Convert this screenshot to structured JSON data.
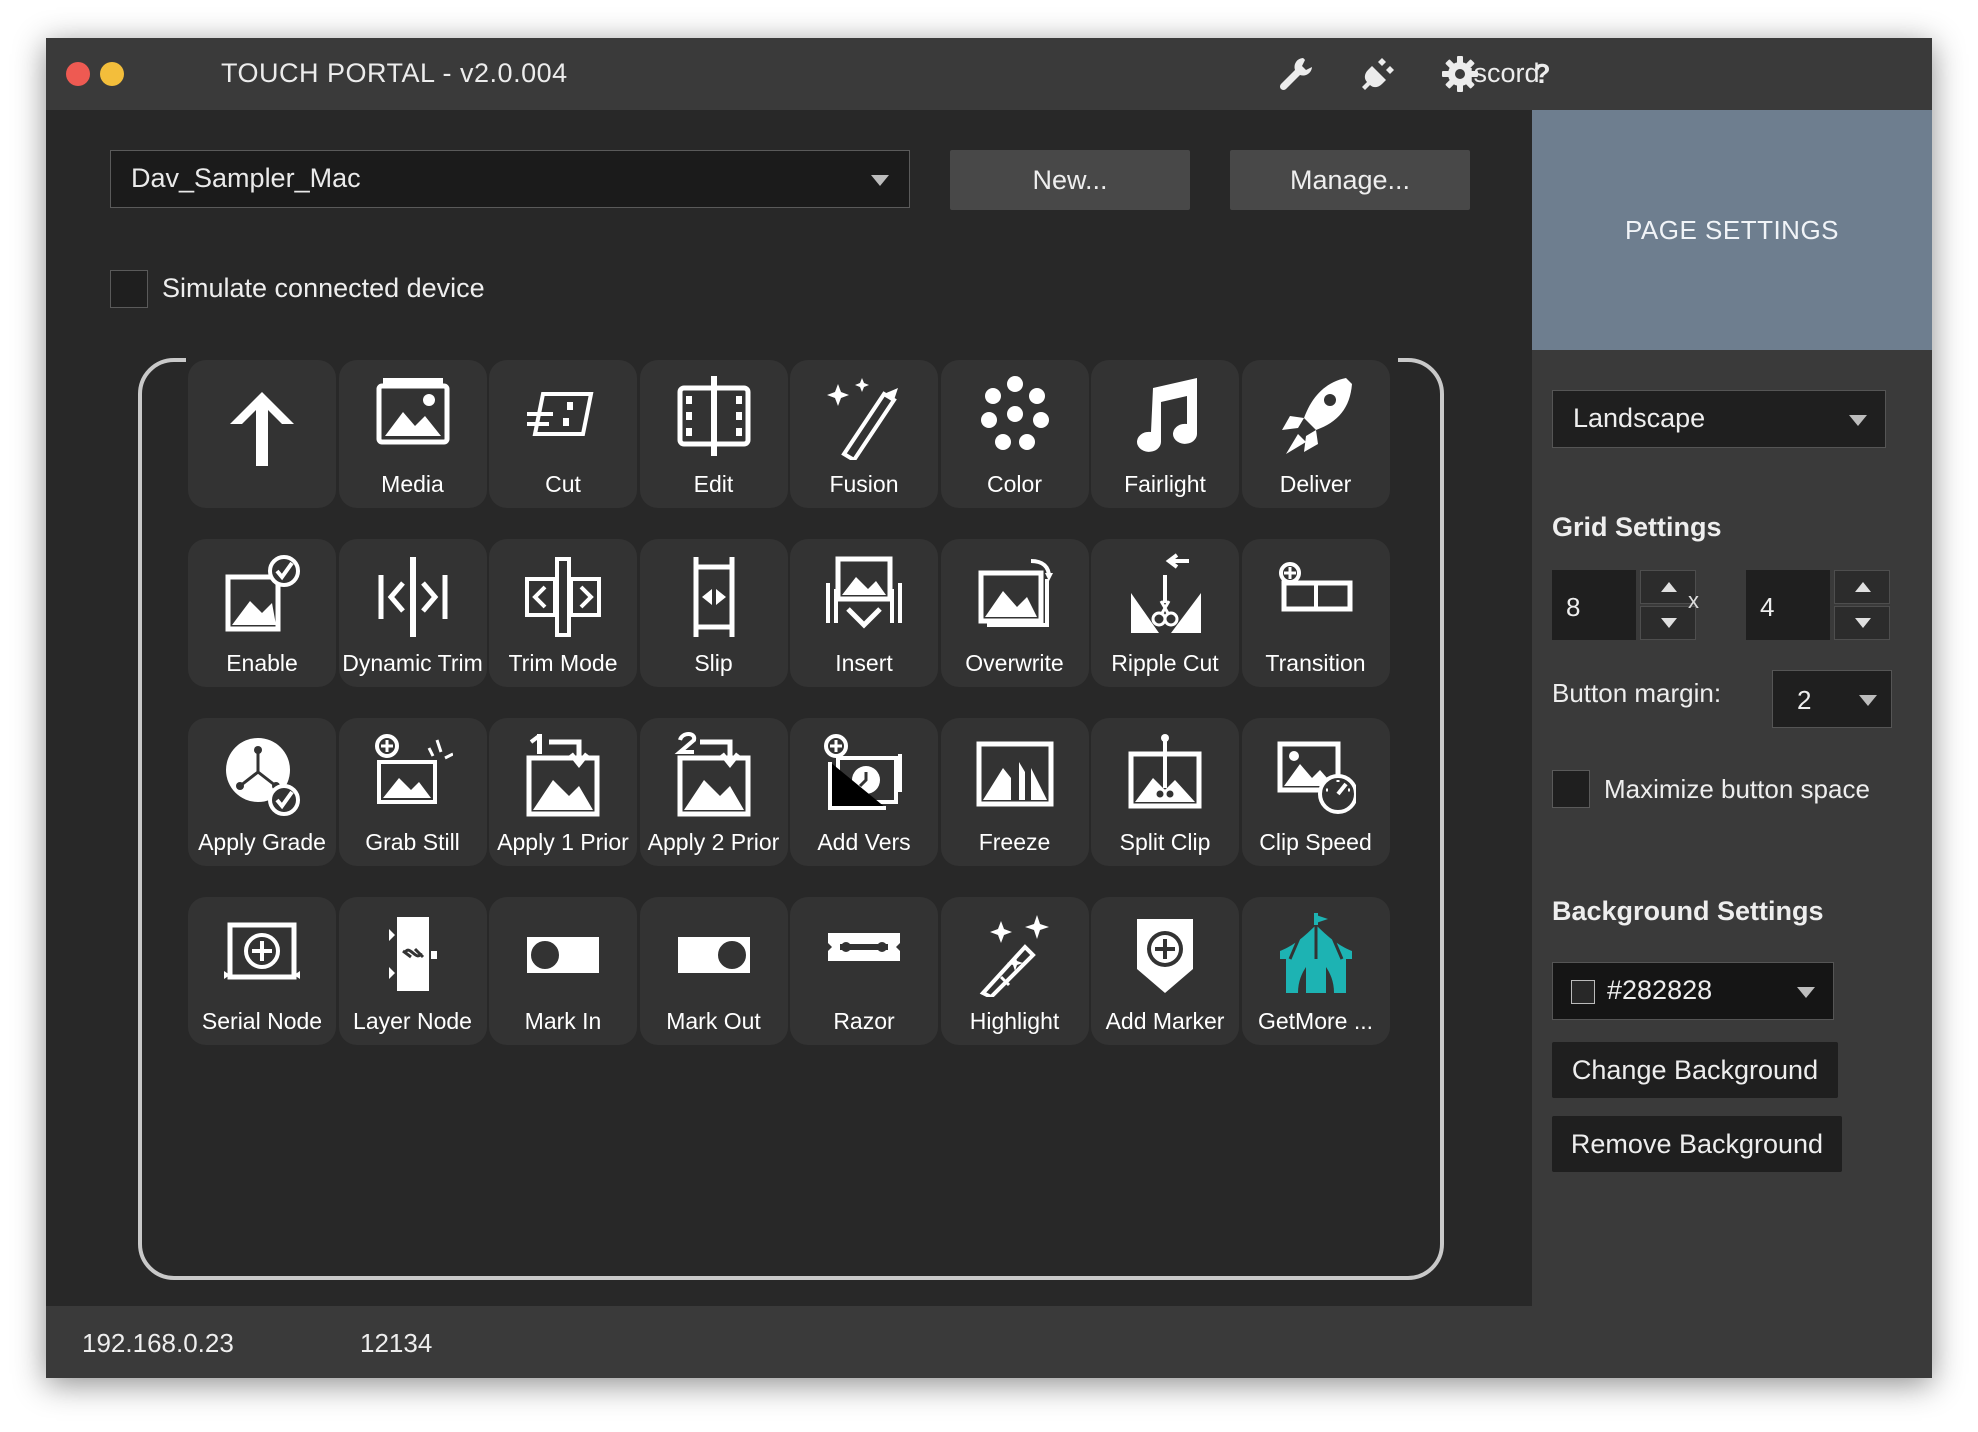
{
  "window": {
    "title": "TOUCH PORTAL - v2.0.004",
    "discord_label": "Discord",
    "help_label": "?",
    "icons": [
      "wrench-icon",
      "plug-icon",
      "gear-icon",
      "help-icon"
    ]
  },
  "toolbar": {
    "page_name": "Dav_Sampler_Mac",
    "new_label": "New...",
    "manage_label": "Manage..."
  },
  "simulate": {
    "label": "Simulate connected device",
    "checked": false
  },
  "grid": {
    "tiles": [
      {
        "label": "",
        "icon": "arrow-up-icon"
      },
      {
        "label": "Media",
        "icon": "media-icon"
      },
      {
        "label": "Cut",
        "icon": "cut-icon"
      },
      {
        "label": "Edit",
        "icon": "edit-icon"
      },
      {
        "label": "Fusion",
        "icon": "fusion-icon"
      },
      {
        "label": "Color",
        "icon": "color-icon"
      },
      {
        "label": "Fairlight",
        "icon": "fairlight-icon"
      },
      {
        "label": "Deliver",
        "icon": "deliver-icon"
      },
      {
        "label": "Enable",
        "icon": "enable-icon"
      },
      {
        "label": "Dynamic Trim",
        "icon": "dynamic-trim-icon"
      },
      {
        "label": "Trim Mode",
        "icon": "trim-mode-icon"
      },
      {
        "label": "Slip",
        "icon": "slip-icon"
      },
      {
        "label": "Insert",
        "icon": "insert-icon"
      },
      {
        "label": "Overwrite",
        "icon": "overwrite-icon"
      },
      {
        "label": "Ripple Cut",
        "icon": "ripple-cut-icon"
      },
      {
        "label": "Transition",
        "icon": "transition-icon"
      },
      {
        "label": "Apply Grade",
        "icon": "apply-grade-icon"
      },
      {
        "label": "Grab Still",
        "icon": "grab-still-icon"
      },
      {
        "label": "Apply 1 Prior",
        "icon": "apply-1-prior-icon"
      },
      {
        "label": "Apply 2 Prior",
        "icon": "apply-2-prior-icon"
      },
      {
        "label": "Add Vers",
        "icon": "add-version-icon"
      },
      {
        "label": "Freeze",
        "icon": "freeze-icon"
      },
      {
        "label": "Split Clip",
        "icon": "split-clip-icon"
      },
      {
        "label": "Clip Speed",
        "icon": "clip-speed-icon"
      },
      {
        "label": "Serial Node",
        "icon": "serial-node-icon"
      },
      {
        "label": "Layer Node",
        "icon": "layer-node-icon"
      },
      {
        "label": "Mark In",
        "icon": "mark-in-icon"
      },
      {
        "label": "Mark Out",
        "icon": "mark-out-icon"
      },
      {
        "label": "Razor",
        "icon": "razor-icon"
      },
      {
        "label": "Highlight",
        "icon": "highlight-icon"
      },
      {
        "label": "Add Marker",
        "icon": "add-marker-icon"
      },
      {
        "label": "GetMore ...",
        "icon": "getmore-tent-icon"
      }
    ]
  },
  "sidebar": {
    "header": "PAGE SETTINGS",
    "orientation": "Landscape",
    "grid_settings_title": "Grid Settings",
    "columns": "8",
    "rows": "4",
    "x_label": "x",
    "button_margin_label": "Button margin:",
    "button_margin": "2",
    "maximize_label": "Maximize button space",
    "background_settings_title": "Background Settings",
    "bg_color": "#282828",
    "change_bg_label": "Change Background",
    "remove_bg_label": "Remove Background"
  },
  "status": {
    "ip": "192.168.0.23",
    "port": "12134"
  },
  "colors": {
    "window_bg": "#282828",
    "panel_bg": "#3a3a3a",
    "header_accent": "#6e7e8f",
    "tile_bg": "#333333",
    "getmore_accent": "#1db3b3",
    "close_red": "#ee5a52",
    "minimize_yellow": "#f3be3b"
  }
}
